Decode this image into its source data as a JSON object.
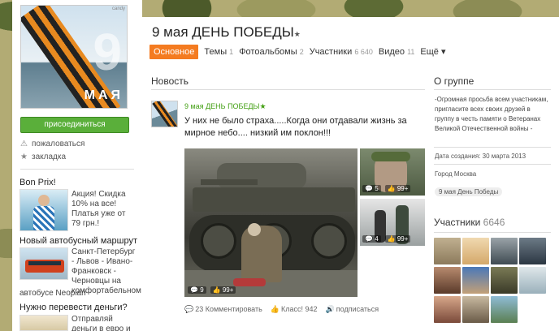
{
  "group": {
    "name": "9 мая ДЕНЬ ПОБЕДЫ",
    "avatar_corner_text": "candy",
    "avatar_text": "МАЯ",
    "join_label": "присоединиться",
    "complain_label": "пожаловаться",
    "bookmark_label": "закладка"
  },
  "tabs": [
    {
      "label": "Основное",
      "count": ""
    },
    {
      "label": "Темы",
      "count": "1"
    },
    {
      "label": "Фотоальбомы",
      "count": "2"
    },
    {
      "label": "Участники",
      "count": "6 640"
    },
    {
      "label": "Видео",
      "count": "11"
    },
    {
      "label": "Ещё ▾",
      "count": ""
    }
  ],
  "news": {
    "heading": "Новость",
    "author": "9 мая ДЕНЬ ПОБЕДЫ",
    "text": "У них не было страха.....Когда они отдавали жизнь за мирное небо.... низкий им поклон!!!",
    "photos": [
      {
        "comments": "9",
        "likes": "99+"
      },
      {
        "comments": "5",
        "likes": "99+"
      },
      {
        "comments": "4",
        "likes": "99+"
      }
    ],
    "actions": {
      "comments": "23 Комментировать",
      "likes": "Класс! 942",
      "subscribe": "подписаться"
    }
  },
  "ads": [
    {
      "title": "Bon Prix!",
      "text": "Акция! Скидка 10% на все! Платья уже от 79 грн.!",
      "foot": ""
    },
    {
      "title": "Новый автобусный маршрут",
      "text": "Санкт-Петербург - Львов - Ивано-Франковск - Черновцы на комфортабельном",
      "foot": "автобусе Neoplan"
    },
    {
      "title": "Нужно перевести деньги?",
      "text": "Отправляй деньги в евро и долларах",
      "foot": ""
    }
  ],
  "about": {
    "heading": "О группе",
    "text": "-Огромная просьба всем участникам, пригласите всех своих друзей в группу в честь памяти о Ветеранах Великой Отечественной войны -",
    "created": "Дата создания: 30 марта 2013",
    "city": "Город Москва",
    "tag": "9 мая День Победы"
  },
  "members": {
    "heading": "Участники",
    "count": "6646"
  },
  "colors": {
    "accent": "#f47b20",
    "join_green": "#5aaf3a",
    "link_green": "#44a015"
  }
}
